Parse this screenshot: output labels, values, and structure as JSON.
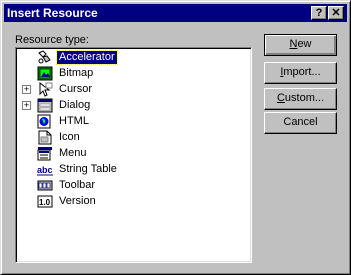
{
  "window": {
    "title": "Insert Resource",
    "help_glyph": "?",
    "close_glyph": "✕"
  },
  "tree": {
    "label": "Resource type:",
    "items": [
      {
        "label": "Accelerator",
        "icon": "accelerator-icon",
        "expandable": false,
        "selected": true
      },
      {
        "label": "Bitmap",
        "icon": "bitmap-icon",
        "expandable": false
      },
      {
        "label": "Cursor",
        "icon": "cursor-icon",
        "expandable": true
      },
      {
        "label": "Dialog",
        "icon": "dialog-icon",
        "expandable": true
      },
      {
        "label": "HTML",
        "icon": "html-icon",
        "expandable": false
      },
      {
        "label": "Icon",
        "icon": "icon-resource-icon",
        "expandable": false
      },
      {
        "label": "Menu",
        "icon": "menu-icon",
        "expandable": false
      },
      {
        "label": "String Table",
        "icon": "string-table-icon",
        "expandable": false
      },
      {
        "label": "Toolbar",
        "icon": "toolbar-icon",
        "expandable": false
      },
      {
        "label": "Version",
        "icon": "version-icon",
        "expandable": false
      }
    ],
    "expand_glyph": "+"
  },
  "buttons": {
    "new": {
      "label": "New",
      "mnemonic": "N"
    },
    "import": {
      "label": "Import...",
      "mnemonic": "I"
    },
    "custom": {
      "label": "Custom...",
      "mnemonic": "C"
    },
    "cancel": {
      "label": "Cancel"
    }
  },
  "icon_text": {
    "string_table": "abc",
    "version": "1.0"
  },
  "colors": {
    "titlebar": "#000080",
    "face": "#c0c0c0",
    "selection": "#000080"
  }
}
